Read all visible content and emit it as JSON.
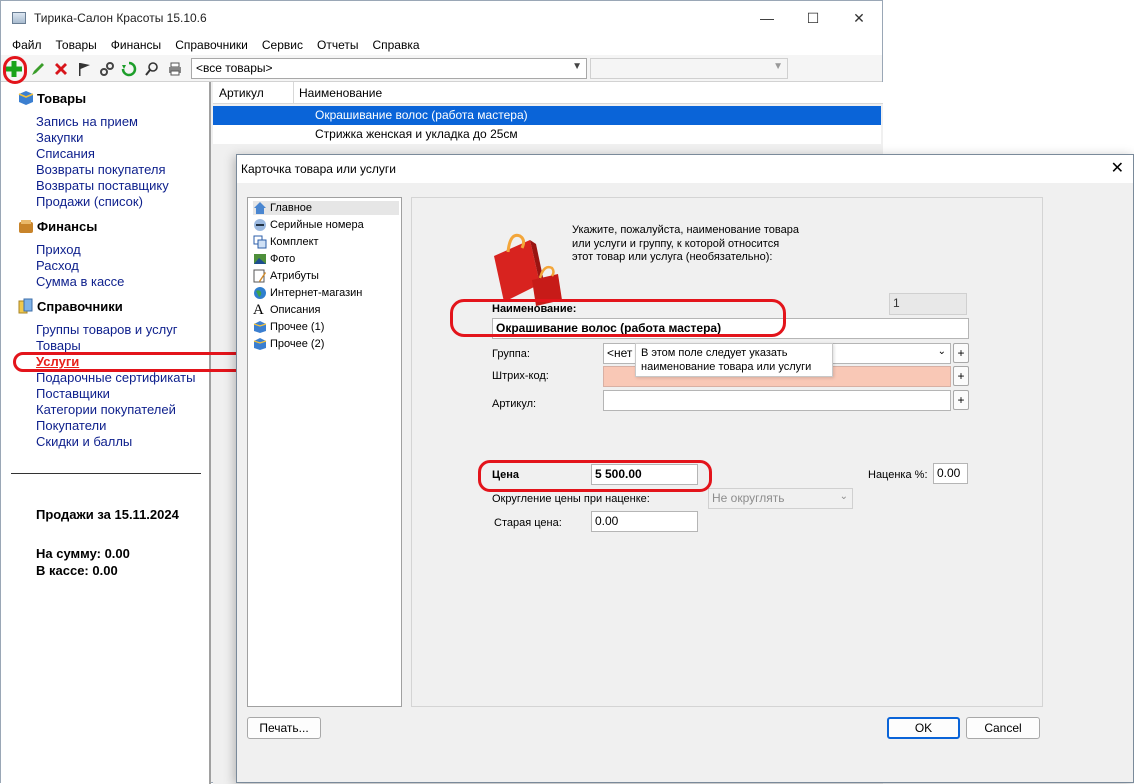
{
  "main_window": {
    "title": "Тирика-Салон Красоты 15.10.6",
    "controls": {
      "minimize": "—",
      "maximize": "☐",
      "close": "✕"
    },
    "menu": [
      "Файл",
      "Товары",
      "Финансы",
      "Справочники",
      "Сервис",
      "Отчеты",
      "Справка"
    ],
    "toolbar": {
      "icons": [
        "add-icon",
        "edit-icon",
        "delete-icon",
        "flag-icon",
        "link-icon",
        "refresh-icon",
        "search-icon",
        "print-icon"
      ],
      "filter_value": "<все товары>",
      "second_filter_value": ""
    }
  },
  "sidebar": {
    "sections": [
      {
        "title": "Товары",
        "items": [
          "Запись на прием",
          "Закупки",
          "Списания",
          "Возвраты покупателя",
          "Возвраты поставщику",
          "Продажи (список)"
        ]
      },
      {
        "title": "Финансы",
        "items": [
          "Приход",
          "Расход",
          "Сумма в кассе"
        ]
      },
      {
        "title": "Справочники",
        "items": [
          "Группы товаров и услуг",
          "Товары",
          "Услуги",
          "Подарочные сертификаты",
          "Поставщики",
          "Категории покупателей",
          "Покупатели",
          "Скидки и баллы"
        ]
      }
    ],
    "active_item": "Услуги",
    "sales_title": "Продажи за 15.11.2024",
    "sum_text": "На сумму: 0.00",
    "cash_text": "В кассе: 0.00"
  },
  "grid": {
    "columns": [
      "Артикул",
      "Наименование"
    ],
    "rows": [
      {
        "article": "",
        "name": "Окрашивание волос (работа мастера)",
        "selected": true
      },
      {
        "article": "",
        "name": "Стрижка женская и укладка до 25см",
        "selected": false
      }
    ]
  },
  "dialog": {
    "title": "Карточка товара или услуги",
    "close": "✕",
    "side_items": [
      "Главное",
      "Серийные номера",
      "Комплект",
      "Фото",
      "Атрибуты",
      "Интернет-магазин",
      "Описания",
      "Прочее (1)",
      "Прочее (2)"
    ],
    "intro_lines": [
      "Укажите, пожалуйста, наименование товара",
      "или услуги и группу, к которой относится",
      "этот товар или услуга (необязательно):"
    ],
    "name_label": "Наименование:",
    "name_value": "Окрашивание волос (работа мастера)",
    "counter_value": "1",
    "group_label": "Группа:",
    "group_value": "<нет г",
    "tooltip_lines": [
      "В этом поле следует указать",
      "наименование товара или услуги"
    ],
    "barcode_label": "Штрих-код:",
    "article_label": "Артикул:",
    "plus": "+",
    "price_label": "Цена",
    "price_value": "5 500.00",
    "markup_label": "Наценка %:",
    "markup_value": "0.00",
    "rounding_label": "Округление цены при наценке:",
    "rounding_value": "Не округлять",
    "old_price_label": "Старая цена:",
    "old_price_value": "0.00",
    "print_button": "Печать...",
    "ok_button": "OK",
    "cancel_button": "Cancel"
  },
  "colors": {
    "selection": "#0a64d8",
    "link": "#0d1f8c",
    "active_link": "#e8201a",
    "annotation": "#e3141b",
    "barcode_field": "#f9c8b6"
  }
}
